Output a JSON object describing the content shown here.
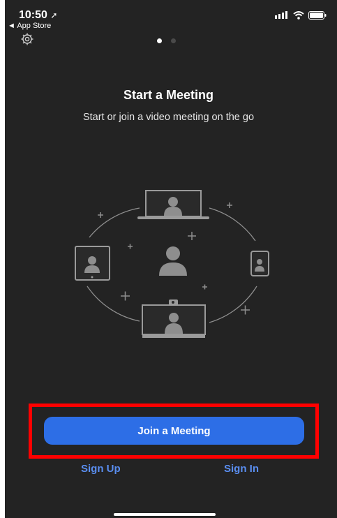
{
  "status_bar": {
    "time": "10:50",
    "back_label": "◄ App Store"
  },
  "onboarding": {
    "title": "Start a Meeting",
    "subtitle": "Start or join a video meeting on the go",
    "page_index": 1,
    "page_count": 2
  },
  "actions": {
    "join_label": "Join a Meeting",
    "sign_up_label": "Sign Up",
    "sign_in_label": "Sign In"
  },
  "colors": {
    "background": "#232323",
    "primary_button": "#2d6ee6",
    "link": "#5a8ef0",
    "highlight": "#ff0000",
    "illustration": "#8e8e8e"
  },
  "icons": [
    "location-arrow-icon",
    "signal-icon",
    "wifi-icon",
    "battery-icon",
    "gear-icon"
  ]
}
